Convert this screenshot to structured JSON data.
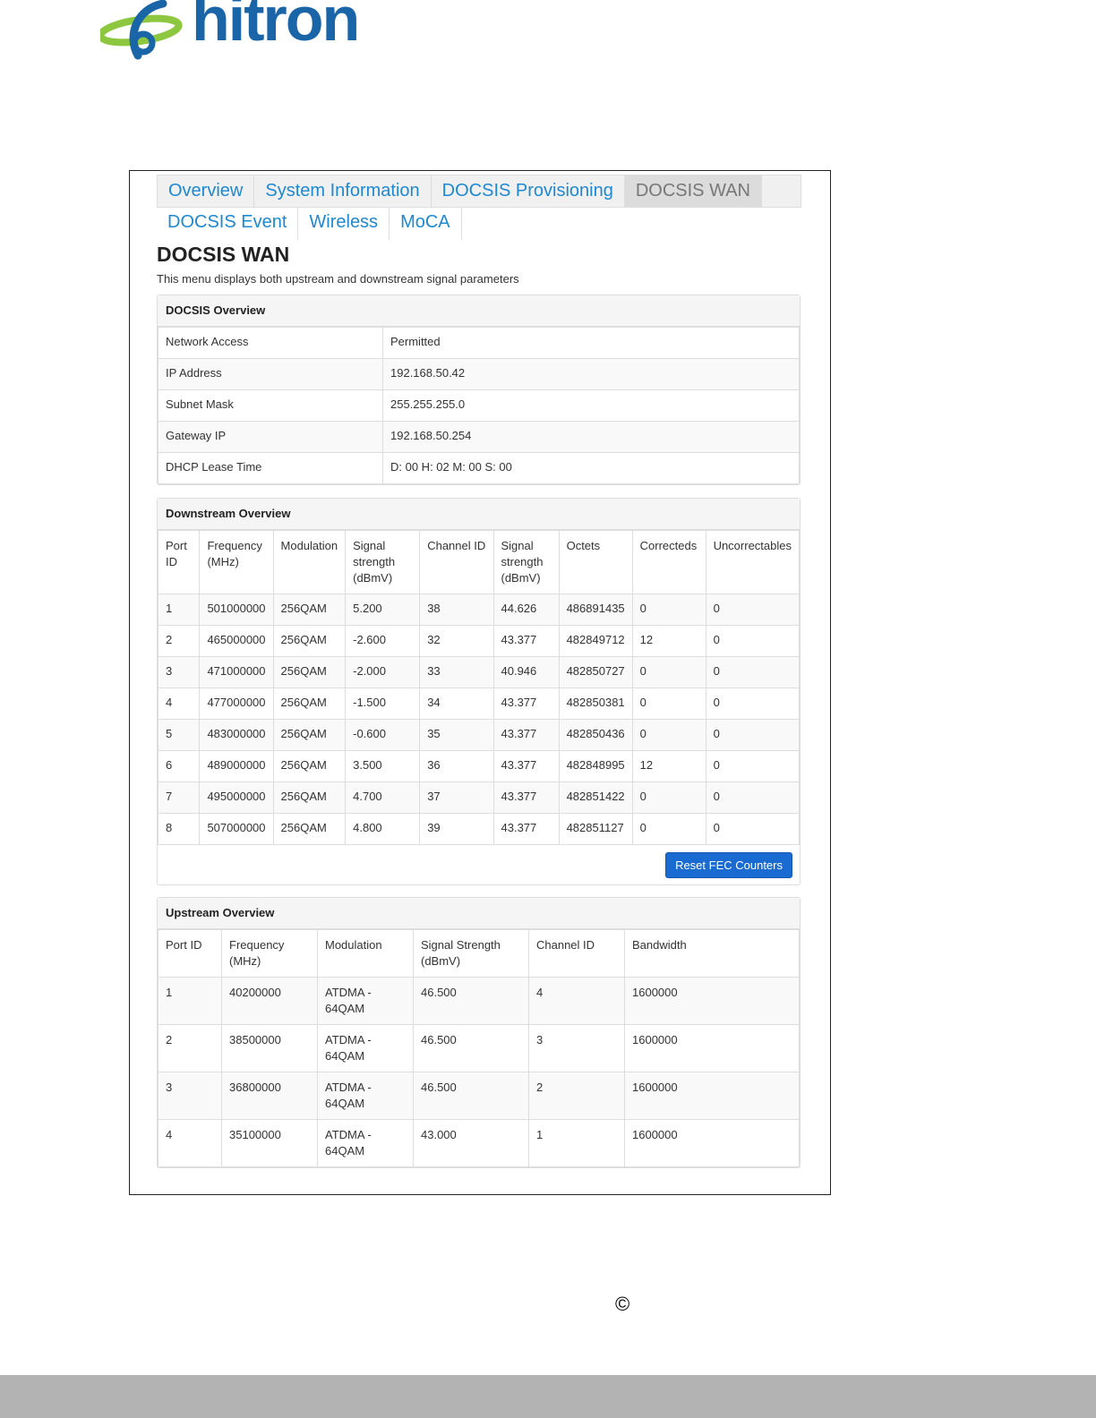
{
  "logo": {
    "text": "hitron"
  },
  "tabs": {
    "row1": [
      "Overview",
      "System Information",
      "DOCSIS Provisioning",
      "DOCSIS WAN"
    ],
    "row2": [
      "DOCSIS Event",
      "Wireless",
      "MoCA"
    ],
    "active": "DOCSIS WAN"
  },
  "page": {
    "title": "DOCSIS WAN",
    "description": "This menu displays both upstream and downstream signal parameters"
  },
  "docsis_overview": {
    "heading": "DOCSIS Overview",
    "rows": [
      [
        "Network Access",
        "Permitted"
      ],
      [
        "IP Address",
        "192.168.50.42"
      ],
      [
        "Subnet Mask",
        "255.255.255.0"
      ],
      [
        "Gateway IP",
        "192.168.50.254"
      ],
      [
        "DHCP Lease Time",
        "D: 00 H: 02 M: 00 S: 00"
      ]
    ]
  },
  "downstream": {
    "heading": "Downstream Overview",
    "headers": [
      "Port ID",
      "Frequency (MHz)",
      "Modulation",
      "Signal strength (dBmV)",
      "Channel ID",
      "Signal strength (dBmV)",
      "Octets",
      "Correcteds",
      "Uncorrectables"
    ],
    "rows": [
      [
        "1",
        "501000000",
        "256QAM",
        "5.200",
        "38",
        "44.626",
        "486891435",
        "0",
        "0"
      ],
      [
        "2",
        "465000000",
        "256QAM",
        "-2.600",
        "32",
        "43.377",
        "482849712",
        "12",
        "0"
      ],
      [
        "3",
        "471000000",
        "256QAM",
        "-2.000",
        "33",
        "40.946",
        "482850727",
        "0",
        "0"
      ],
      [
        "4",
        "477000000",
        "256QAM",
        "-1.500",
        "34",
        "43.377",
        "482850381",
        "0",
        "0"
      ],
      [
        "5",
        "483000000",
        "256QAM",
        "-0.600",
        "35",
        "43.377",
        "482850436",
        "0",
        "0"
      ],
      [
        "6",
        "489000000",
        "256QAM",
        "3.500",
        "36",
        "43.377",
        "482848995",
        "12",
        "0"
      ],
      [
        "7",
        "495000000",
        "256QAM",
        "4.700",
        "37",
        "43.377",
        "482851422",
        "0",
        "0"
      ],
      [
        "8",
        "507000000",
        "256QAM",
        "4.800",
        "39",
        "43.377",
        "482851127",
        "0",
        "0"
      ]
    ],
    "button": "Reset FEC Counters"
  },
  "upstream": {
    "heading": "Upstream Overview",
    "headers": [
      "Port ID",
      "Frequency (MHz)",
      "Modulation",
      "Signal Strength (dBmV)",
      "Channel ID",
      "Bandwidth"
    ],
    "rows": [
      [
        "1",
        "40200000",
        "ATDMA - 64QAM",
        "46.500",
        "4",
        "1600000"
      ],
      [
        "2",
        "38500000",
        "ATDMA - 64QAM",
        "46.500",
        "3",
        "1600000"
      ],
      [
        "3",
        "36800000",
        "ATDMA - 64QAM",
        "46.500",
        "2",
        "1600000"
      ],
      [
        "4",
        "35100000",
        "ATDMA - 64QAM",
        "43.000",
        "1",
        "1600000"
      ]
    ]
  },
  "footer": {
    "copyright": "©"
  },
  "colors": {
    "brand_blue": "#1a64a8",
    "logo_green": "#8dc63f",
    "tab_link": "#1e88d1",
    "button": "#1a6bd1",
    "footer_bar": "#b3b3b3"
  }
}
